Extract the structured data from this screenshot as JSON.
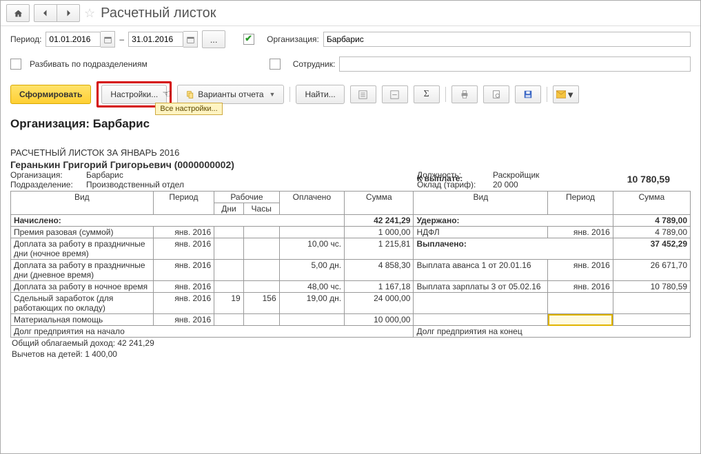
{
  "title": "Расчетный листок",
  "period": {
    "label": "Период:",
    "from": "01.01.2016",
    "dash": "–",
    "to": "31.01.2016"
  },
  "org_field": {
    "label": "Организация:",
    "value": "Барбарис"
  },
  "split_chk": {
    "label": "Разбивать по подразделениям"
  },
  "employee_field": {
    "label": "Сотрудник:",
    "value": ""
  },
  "toolbar": {
    "form": "Сформировать",
    "settings": "Настройки...",
    "variants": "Варианты отчета",
    "find": "Найти...",
    "tooltip": "Все настройки..."
  },
  "report": {
    "org_header": "Организация: Барбарис",
    "title": "РАСЧЕТНЫЙ ЛИСТОК ЗА ЯНВАРЬ 2016",
    "employee": "Геранькин Григорий Григорьевич (0000000002)",
    "org": {
      "k": "Организация:",
      "v": "Барбарис"
    },
    "dep": {
      "k": "Подразделение:",
      "v": "Производственный отдел"
    },
    "to_pay": {
      "k": "К выплате:",
      "v": "10 780,59"
    },
    "position": {
      "k": "Должность:",
      "v": "Раскройщик"
    },
    "rate": {
      "k": "Оклад (тариф):",
      "v": "20 000"
    },
    "headers": {
      "vid": "Вид",
      "period": "Период",
      "work": "Рабочие",
      "days": "Дни",
      "hours": "Часы",
      "paid": "Оплачено",
      "sum": "Сумма"
    },
    "accrued": {
      "label": "Начислено:",
      "total": "42 241,29"
    },
    "withheld": {
      "label": "Удержано:",
      "total": "4 789,00"
    },
    "paid": {
      "label": "Выплачено:",
      "total": "37 452,29"
    },
    "left": [
      {
        "name": "Премия разовая (суммой)",
        "per": "янв. 2016",
        "dni": "",
        "chas": "",
        "opl": "",
        "sum": "1 000,00"
      },
      {
        "name": "Доплата за работу в праздничные дни (ночное время)",
        "per": "янв. 2016",
        "dni": "",
        "chas": "",
        "opl": "10,00 чс.",
        "sum": "1 215,81"
      },
      {
        "name": "Доплата за работу в праздничные дни (дневное время)",
        "per": "янв. 2016",
        "dni": "",
        "chas": "",
        "opl": "5,00 дн.",
        "sum": "4 858,30"
      },
      {
        "name": "Доплата за работу в ночное время",
        "per": "янв. 2016",
        "dni": "",
        "chas": "",
        "opl": "48,00 чс.",
        "sum": "1 167,18"
      },
      {
        "name": "Сдельный заработок (для работающих по окладу)",
        "per": "янв. 2016",
        "dni": "19",
        "chas": "156",
        "opl": "19,00 дн.",
        "sum": "24 000,00"
      },
      {
        "name": "Материальная помощь",
        "per": "янв. 2016",
        "dni": "",
        "chas": "",
        "opl": "",
        "sum": "10 000,00"
      }
    ],
    "right_withheld": [
      {
        "name": "НДФЛ",
        "per": "янв. 2016",
        "sum": "4 789,00"
      }
    ],
    "right_paid": [
      {
        "name": "Выплата аванса 1 от 20.01.16",
        "per": "янв. 2016",
        "sum": "26 671,70"
      },
      {
        "name": "Выплата зарплаты 3 от 05.02.16",
        "per": "янв. 2016",
        "sum": "10 780,59"
      }
    ],
    "debt_start": "Долг предприятия на начало",
    "debt_end": "Долг предприятия на конец",
    "foot1": "Общий облагаемый доход: 42 241,29",
    "foot2": "Вычетов на детей: 1 400,00"
  }
}
